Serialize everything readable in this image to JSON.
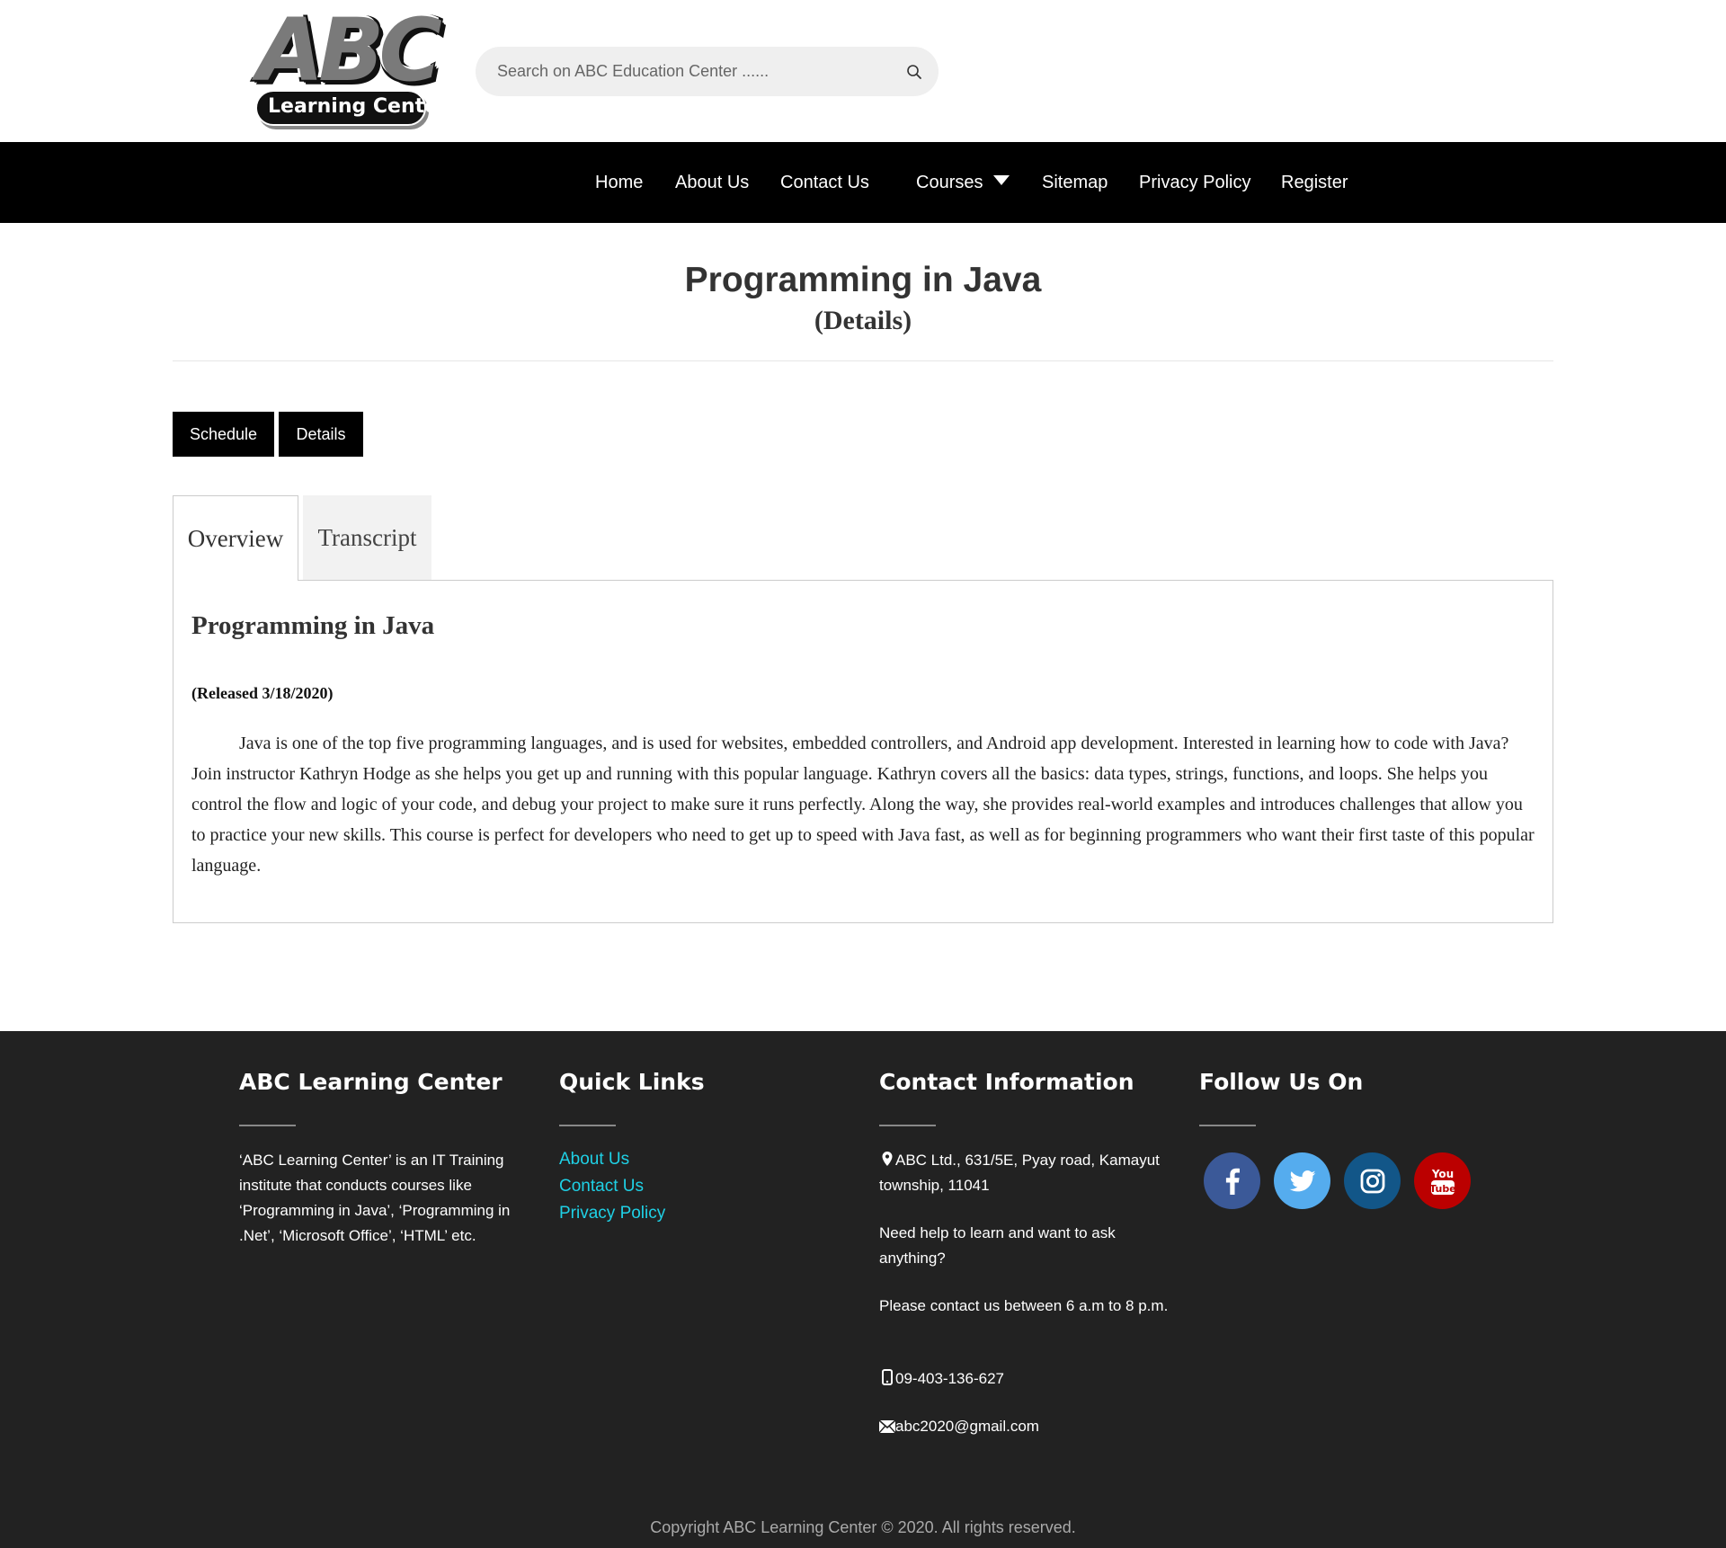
{
  "header": {
    "logo": {
      "main": "ABC",
      "sub": "Learning Center"
    },
    "search": {
      "placeholder": "Search on ABC Education Center ......",
      "icon": "search-icon"
    }
  },
  "nav": {
    "items": [
      "Home",
      "About Us",
      "Contact Us",
      "Courses",
      "Sitemap",
      "Privacy Policy",
      "Register"
    ]
  },
  "main": {
    "title": "Programming in Java",
    "subtitle": "(Details)",
    "buttons": {
      "schedule": "Schedule",
      "details": "Details"
    },
    "tabs": [
      "Overview",
      "Transcript"
    ],
    "content": {
      "heading": "Programming in Java",
      "released": "(Released 3/18/2020)",
      "body": "Java is one of the top five programming languages, and is used for websites, embedded controllers, and Android app development. Interested in learning how to code with Java? Join instructor Kathryn Hodge as she helps you get up and running with this popular language. Kathryn covers all the basics: data types, strings, functions, and loops. She helps you control the flow and logic of your code, and debug your project to make sure it runs perfectly. Along the way, she provides real-world examples and introduces challenges that allow you to practice your new skills. This course is perfect for developers who need to get up to speed with Java fast, as well as for beginning programmers who want their first taste of this popular language."
    }
  },
  "footer": {
    "about": {
      "heading": "ABC Learning Center",
      "text": "‘ABC Learning Center’ is an IT Training institute that conducts courses like ‘Programming in Java’, ‘Programming in .Net’, ‘Microsoft Office’, ‘HTML’ etc."
    },
    "quick_links": {
      "heading": "Quick Links",
      "items": [
        "About Us",
        "Contact Us",
        "Privacy Policy"
      ]
    },
    "contact": {
      "heading": "Contact Information",
      "address": "ABC Ltd., 631/5E, Pyay road, Kamayut township, 11041",
      "help": "Need help to learn and want to ask anything?",
      "hours": "Please contact us between 6 a.m to 8 p.m.",
      "phone": "09-403-136-627",
      "email": "abc2020@gmail.com"
    },
    "follow": {
      "heading": "Follow Us On",
      "icons": [
        "facebook-icon",
        "twitter-icon",
        "instagram-icon",
        "youtube-icon"
      ],
      "youtube_glyph": {
        "top": "You",
        "bottom": "Tube"
      },
      "colors": {
        "facebook": "#3b5998",
        "twitter": "#55acee",
        "instagram": "#125688",
        "youtube": "#bb0000"
      }
    },
    "copyright": "Copyright  ABC Learning Center © 2020. All rights reserved."
  }
}
